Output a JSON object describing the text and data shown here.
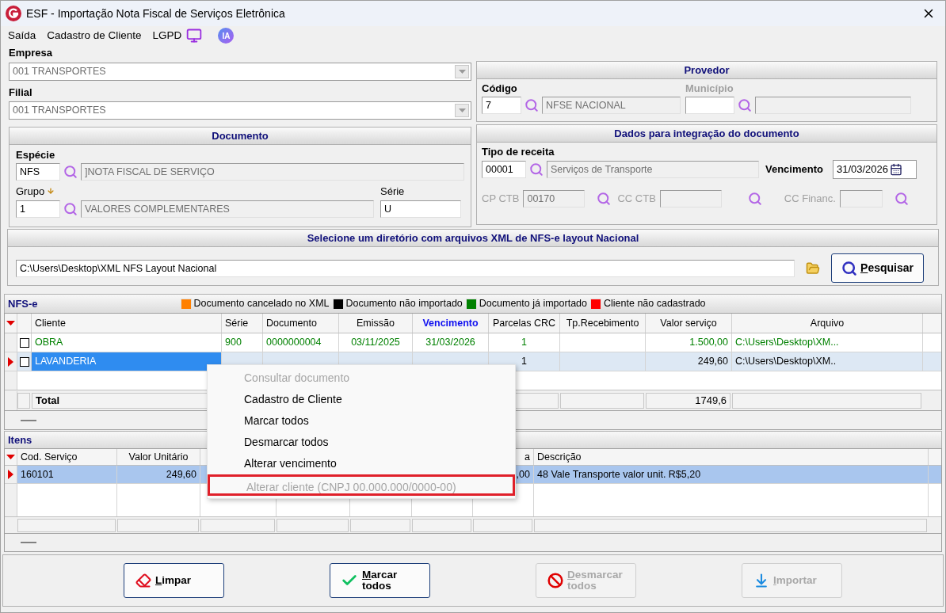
{
  "window": {
    "title": "ESF - Importação Nota Fiscal de Serviços Eletrônica"
  },
  "menu": [
    {
      "label": "Saída"
    },
    {
      "label": "Cadastro de Cliente"
    },
    {
      "label": "LGPD"
    }
  ],
  "ia_badge": "IA",
  "empresa": {
    "label": "Empresa",
    "value": "001 TRANSPORTES"
  },
  "filial": {
    "label": "Filial",
    "value": "001 TRANSPORTES"
  },
  "documento": {
    "title": "Documento",
    "especie_label": "Espécie",
    "especie_code": "NFS",
    "especie_name": "]NOTA FISCAL DE SERVIÇO",
    "grupo_label": "Grupo",
    "grupo_code": "1",
    "grupo_name": "VALORES COMPLEMENTARES",
    "serie_label": "Série",
    "serie": "U"
  },
  "provedor": {
    "title": "Provedor",
    "codigo_label": "Código",
    "codigo": "7",
    "nome": "NFSE NACIONAL",
    "municipio_label": "Município",
    "municipio_disabled": true
  },
  "integracao": {
    "title": "Dados para integração do documento",
    "tipo_label": "Tipo de receita",
    "tipo_code": "00001",
    "tipo_name": "Serviços de Transporte",
    "vencimento_label": "Vencimento",
    "vencimento": "31/03/2026",
    "accounts": [
      {
        "label": "CP CTB",
        "value": "00170",
        "disabled": true
      },
      {
        "label": "CC CTB",
        "disabled": true
      },
      {
        "label": "CC Financ.",
        "disabled": true
      }
    ]
  },
  "diretorio": {
    "title": "Selecione um diretório com arquivos XML de NFS-e layout Nacional",
    "path": "C:\\Users\\Desktop\\XML NFS Layout Nacional",
    "search_button": "Pesquisar"
  },
  "nfse": {
    "title": "NFS-e",
    "legend": [
      {
        "label": "Documento cancelado no XML",
        "color": "#ff8000"
      },
      {
        "label": "Documento não importado",
        "color": "#000000"
      },
      {
        "label": "Documento já importado",
        "color": "#008000"
      },
      {
        "label": "Cliente não cadastrado",
        "color": "#ff0000"
      }
    ],
    "columns": [
      {
        "label": "Cliente",
        "highlighted": false
      },
      {
        "label": "Série",
        "highlighted": false
      },
      {
        "label": "Documento",
        "highlighted": false
      },
      {
        "label": "Emissão",
        "highlighted": false
      },
      {
        "label": "Vencimento",
        "highlighted": true
      },
      {
        "label": "Parcelas CRC",
        "highlighted": false
      },
      {
        "label": "Tp.Recebimento",
        "highlighted": false
      },
      {
        "label": "Valor serviço",
        "highlighted": false
      },
      {
        "label": "Arquivo",
        "highlighted": false
      }
    ],
    "rows": [
      {
        "checked": false,
        "selected": false,
        "color": "#008000",
        "cells": [
          "OBRA",
          "900",
          "0000000004",
          "03/11/2025",
          "31/03/2026",
          "1",
          null,
          "1.500,00",
          "C:\\Users\\Desktop\\XM..."
        ]
      },
      {
        "checked": false,
        "selected": true,
        "color": "#000000",
        "cells": [
          "LAVANDERIA",
          null,
          null,
          null,
          null,
          "1",
          null,
          "249,60",
          "C:\\Users\\Desktop\\XM.."
        ]
      }
    ],
    "total": {
      "label": "Total",
      "value": "1749,6"
    }
  },
  "itens": {
    "title": "Itens",
    "columns": [
      "Cod. Serviço",
      "Valor Unitário",
      null,
      null,
      null,
      null,
      "a",
      "Descrição"
    ],
    "rows": [
      {
        "selected": true,
        "cells": [
          "160101",
          "249,60",
          null,
          null,
          null,
          null,
          ",00",
          "48 Vale Transporte valor unit. R$5,20"
        ]
      }
    ]
  },
  "context_menu": [
    {
      "label": "Consultar documento",
      "disabled": true,
      "highlighted": false
    },
    {
      "label": "Cadastro de Cliente",
      "disabled": false,
      "highlighted": false
    },
    {
      "label": "Marcar todos",
      "disabled": false,
      "highlighted": false
    },
    {
      "label": "Desmarcar todos",
      "disabled": false,
      "highlighted": false
    },
    {
      "label": "Alterar vencimento",
      "disabled": false,
      "highlighted": false
    },
    {
      "label": "Alterar cliente (CNPJ 00.000.000/0000-00)",
      "disabled": true,
      "highlighted": true
    }
  ],
  "buttons": [
    {
      "kind": "clear",
      "label": "Limpar",
      "disabled": false
    },
    {
      "kind": "mark",
      "label": "Marcar todos",
      "disabled": false
    },
    {
      "kind": "unmark",
      "label": "Desmarcar todos",
      "disabled": true
    },
    {
      "kind": "import",
      "label": "Importar",
      "disabled": true
    }
  ]
}
